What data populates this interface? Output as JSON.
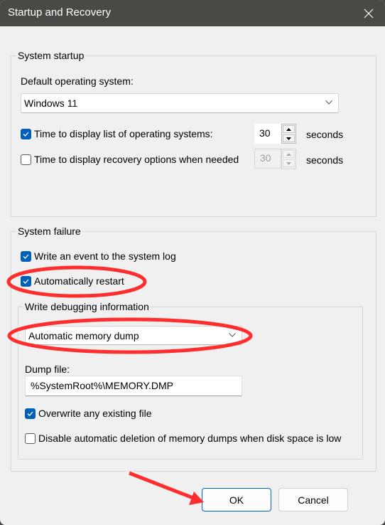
{
  "window": {
    "title": "Startup and Recovery",
    "close_icon": "close-icon"
  },
  "system_startup": {
    "group_label": "System startup",
    "default_os_label": "Default operating system:",
    "default_os_value": "Windows 11",
    "display_list": {
      "label": "Time to display list of operating systems:",
      "checked": true,
      "value": "30",
      "unit": "seconds",
      "enabled": true
    },
    "display_recovery": {
      "label": "Time to display recovery options when needed",
      "checked": false,
      "value": "30",
      "unit": "seconds",
      "enabled": false
    }
  },
  "system_failure": {
    "group_label": "System failure",
    "write_event": {
      "label": "Write an event to the system log",
      "checked": true
    },
    "auto_restart": {
      "label": "Automatically restart",
      "checked": true
    },
    "debug_info": {
      "group_label": "Write debugging information",
      "dump_type": "Automatic memory dump",
      "dump_file_label": "Dump file:",
      "dump_file_value": "%SystemRoot%\\MEMORY.DMP",
      "overwrite": {
        "label": "Overwrite any existing file",
        "checked": true
      },
      "disable_auto_delete": {
        "label": "Disable automatic deletion of memory dumps when disk space is low",
        "checked": false
      }
    }
  },
  "buttons": {
    "ok": "OK",
    "cancel": "Cancel"
  },
  "annotations": {
    "color": "#ff2e2e",
    "highlights": [
      "Automatically restart",
      "Automatic memory dump"
    ],
    "arrow_target": "OK"
  },
  "colors": {
    "titlebar": "#4a4946",
    "accent": "#005fb8",
    "dialog_bg": "#f0f0f0"
  }
}
